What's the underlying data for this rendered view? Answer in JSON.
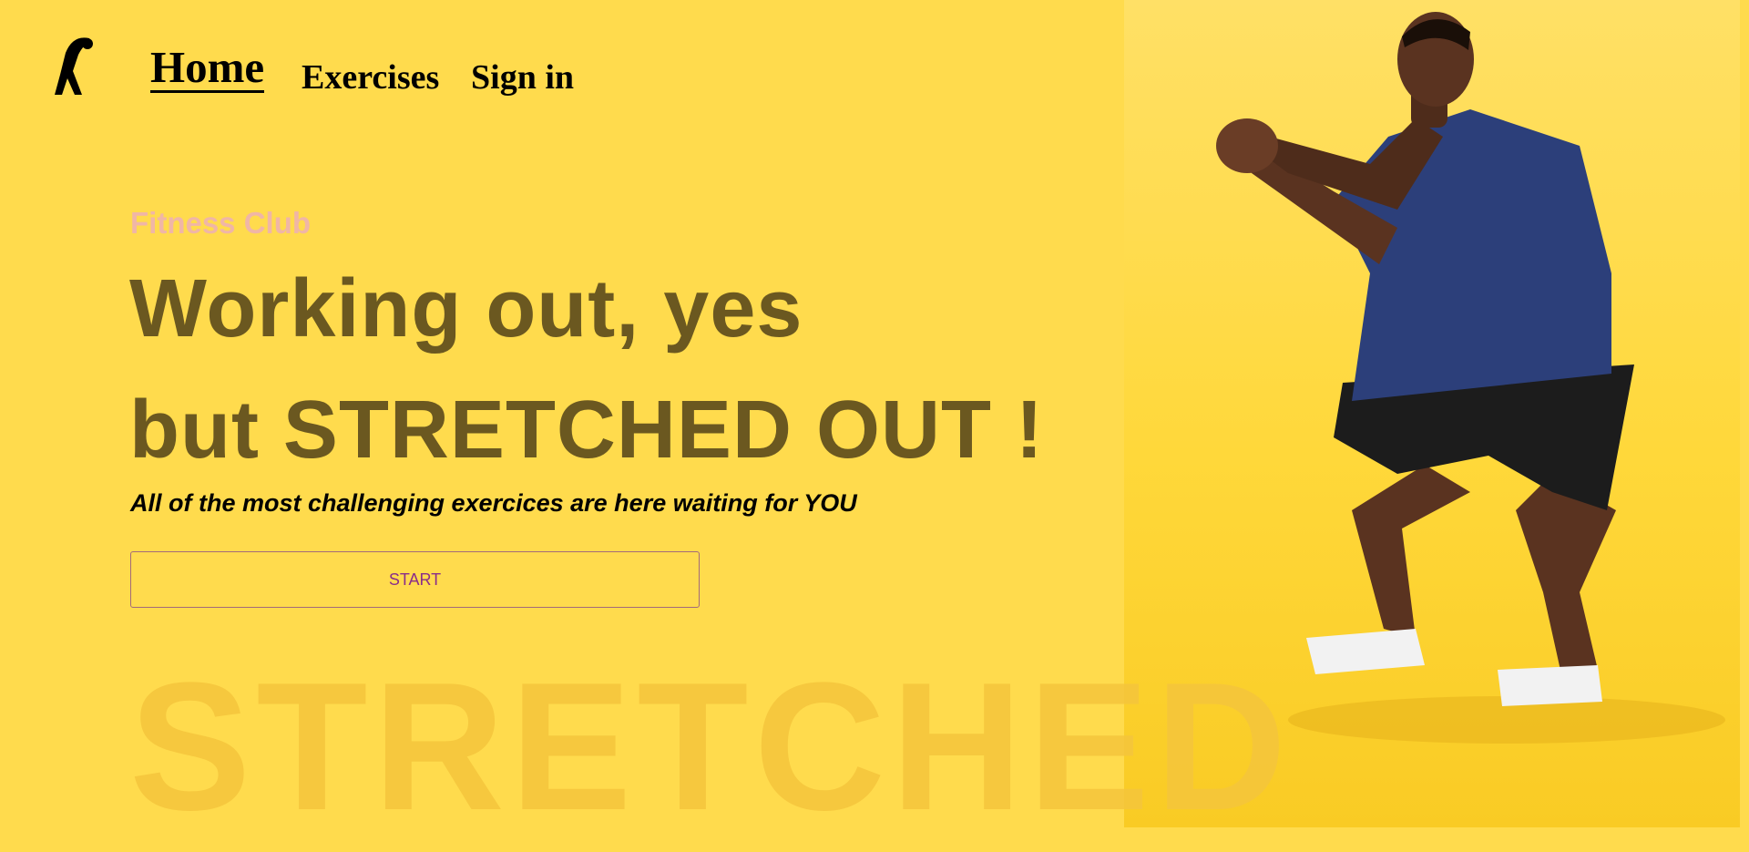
{
  "nav": {
    "home_label": "Home",
    "exercises_label": "Exercises",
    "signin_label": "Sign in",
    "logo_icon": "stretching-person-icon"
  },
  "hero": {
    "eyebrow": "Fitness Club",
    "headline_line1": "Working out, yes",
    "headline_line2": "but STRETCHED OUT !",
    "subline": "All of the most challenging exercices are here waiting for YOU",
    "start_label": "START",
    "watermark": "STRETCHED",
    "photo_icon": "man-squatting-photo"
  },
  "colors": {
    "background": "#ffdb4d",
    "headline": "#6b5820",
    "eyebrow": "#f0b6a6",
    "button_text": "#8a2d8a"
  }
}
